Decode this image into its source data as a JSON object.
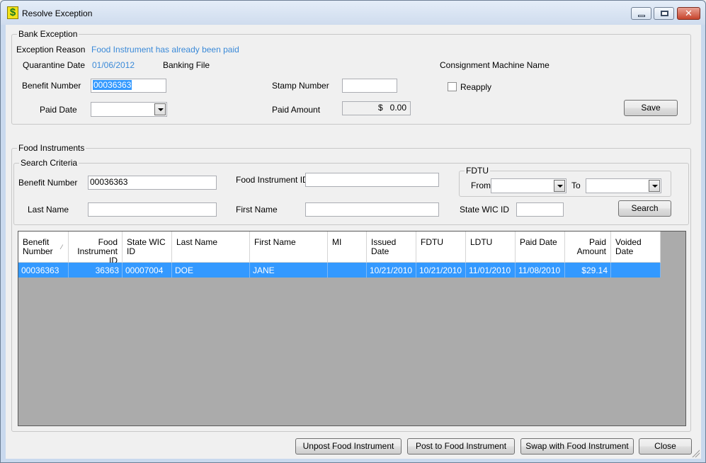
{
  "window": {
    "title": "Resolve Exception",
    "close_glyph": "✕"
  },
  "bank_exception": {
    "group_title": "Bank Exception",
    "exception_reason_label": "Exception Reason",
    "exception_reason_value": "Food Instrument has already been paid",
    "quarantine_date_label": "Quarantine Date",
    "quarantine_date_value": "01/06/2012",
    "banking_file_label": "Banking File",
    "consignment_label": "Consignment Machine Name",
    "benefit_number_label": "Benefit Number",
    "benefit_number_value": "00036363",
    "stamp_number_label": "Stamp Number",
    "stamp_number_value": "",
    "reapply_label": "Reapply",
    "paid_date_label": "Paid Date",
    "paid_date_value": "",
    "paid_amount_label": "Paid Amount",
    "paid_amount_currency": "$",
    "paid_amount_value": "0.00",
    "save_label": "Save"
  },
  "food_instruments": {
    "group_title": "Food Instruments",
    "search_criteria_title": "Search Criteria",
    "benefit_number_label": "Benefit Number",
    "benefit_number_value": "00036363",
    "food_instrument_id_label": "Food Instrument ID",
    "food_instrument_id_value": "",
    "last_name_label": "Last Name",
    "last_name_value": "",
    "first_name_label": "First Name",
    "first_name_value": "",
    "fdtu_title": "FDTU",
    "from_label": "From",
    "to_label": "To",
    "state_wic_id_label": "State WIC ID",
    "state_wic_id_value": "",
    "search_label": "Search"
  },
  "grid": {
    "sort_glyph": "⁄",
    "columns": [
      "Benefit Number",
      "Food Instrument ID",
      "State WIC ID",
      "Last Name",
      "First Name",
      "MI",
      "Issued Date",
      "FDTU",
      "LDTU",
      "Paid Date",
      "Paid Amount",
      "Voided Date"
    ],
    "rows": [
      [
        "00036363",
        "36363",
        "00007004",
        "DOE",
        "JANE",
        "",
        "10/21/2010",
        "10/21/2010",
        "11/01/2010",
        "11/08/2010",
        "$29.14",
        ""
      ]
    ]
  },
  "footer": {
    "unpost_label": "Unpost Food Instrument",
    "post_label": "Post to Food Instrument",
    "swap_label": "Swap with Food Instrument",
    "close_label": "Close"
  }
}
